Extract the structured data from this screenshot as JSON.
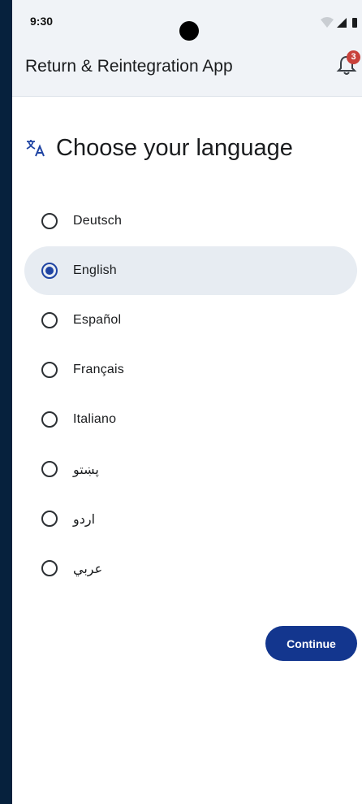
{
  "status_bar": {
    "time": "9:30",
    "icons": [
      "wifi-icon",
      "signal-icon",
      "battery-icon"
    ]
  },
  "app_bar": {
    "title": "Return & Reintegration App",
    "notification_icon": "bell-icon",
    "notification_count": "3"
  },
  "page": {
    "heading_icon": "translate-icon",
    "heading": "Choose your language"
  },
  "languages": [
    {
      "label": "Deutsch",
      "selected": false
    },
    {
      "label": "English",
      "selected": true
    },
    {
      "label": "Español",
      "selected": false
    },
    {
      "label": "Français",
      "selected": false
    },
    {
      "label": "Italiano",
      "selected": false
    },
    {
      "label": "پښتو",
      "selected": false
    },
    {
      "label": "اردو",
      "selected": false
    },
    {
      "label": "عربي",
      "selected": false
    }
  ],
  "actions": {
    "continue_label": "Continue"
  },
  "colors": {
    "primary": "#13368e",
    "selected_row": "#e7ecf2",
    "badge": "#c8413b",
    "frame": "#06213d"
  }
}
